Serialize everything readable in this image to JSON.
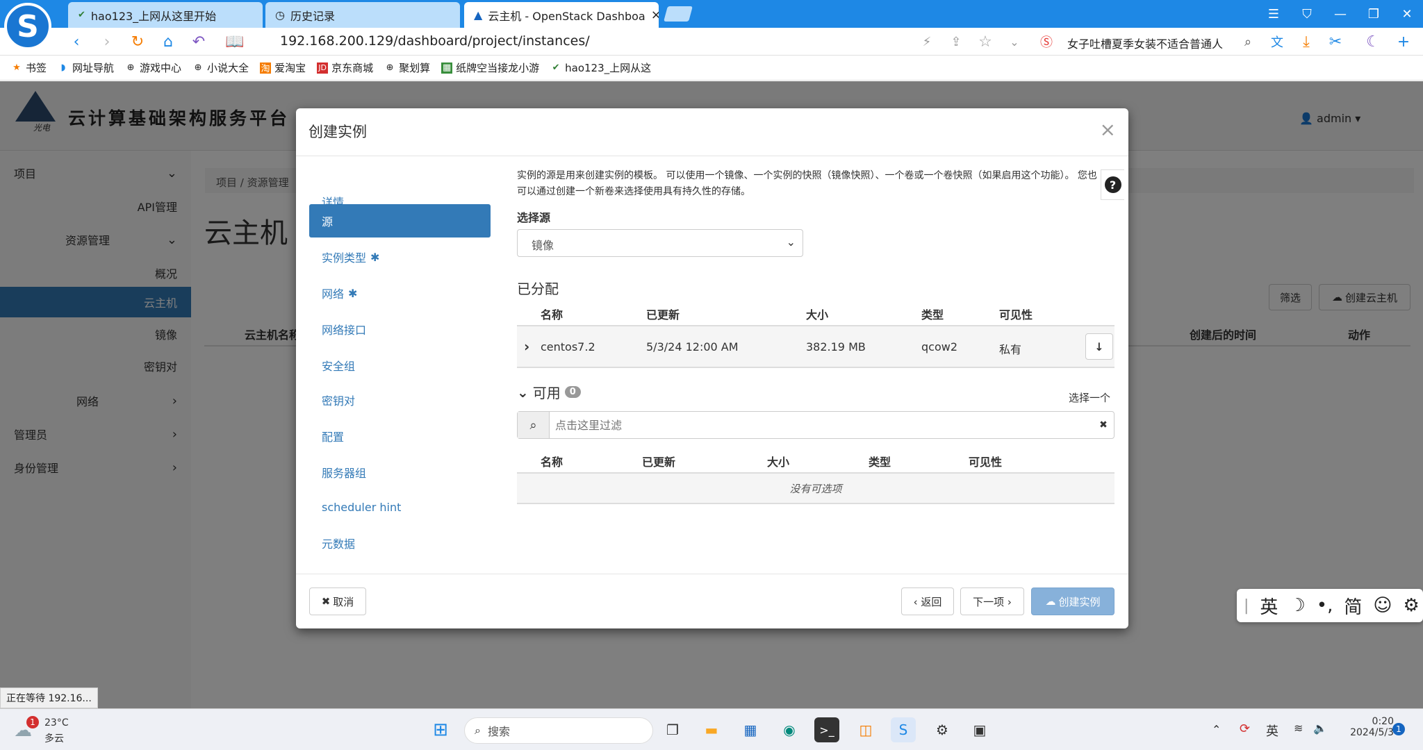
{
  "browser": {
    "logo": "S",
    "tabs": [
      {
        "label": "hao123_上网从这里开始",
        "icon": "hao123-icon"
      },
      {
        "label": "历史记录",
        "icon": "history-icon"
      },
      {
        "label": "云主机 - OpenStack Dashboa",
        "icon": "openstack-icon",
        "close": "×"
      }
    ],
    "url": "192.168.200.129/dashboard/project/instances/",
    "search_hint": "女子吐槽夏季女装不适合普通人",
    "bookmarks": [
      "书签",
      "网址导航",
      "游戏中心",
      "小说大全",
      "爱淘宝",
      "京东商城",
      "聚划算",
      "纸牌空当接龙小游",
      "hao123_上网从这"
    ]
  },
  "page": {
    "brand": "云计算基础架构服务平台",
    "brand_sub": "光电",
    "user": "admin",
    "title": "云主机",
    "breadcrumb": [
      "项目",
      "资源管理"
    ],
    "sidebar": [
      {
        "label": "项目"
      },
      {
        "label": "API管理"
      },
      {
        "label": "资源管理"
      },
      {
        "label": "概况"
      },
      {
        "label": "云主机"
      },
      {
        "label": "镜像"
      },
      {
        "label": "密钥对"
      },
      {
        "label": "网络"
      },
      {
        "label": "管理员"
      },
      {
        "label": "身份管理"
      }
    ],
    "filter_btn": "筛选",
    "create_btn": "创建云主机",
    "table_headers": [
      "云主机名称",
      "创建后的时间",
      "动作"
    ]
  },
  "modal": {
    "title": "创建实例",
    "close": "×",
    "steps": [
      {
        "label": "详情",
        "required": false
      },
      {
        "label": "源",
        "required": false
      },
      {
        "label": "实例类型",
        "required": true
      },
      {
        "label": "网络",
        "required": true
      },
      {
        "label": "网络接口",
        "required": false
      },
      {
        "label": "安全组",
        "required": false
      },
      {
        "label": "密钥对",
        "required": false
      },
      {
        "label": "配置",
        "required": false
      },
      {
        "label": "服务器组",
        "required": false
      },
      {
        "label": "scheduler hint",
        "required": false
      },
      {
        "label": "元数据",
        "required": false
      }
    ],
    "description": "实例的源是用来创建实例的模板。 可以使用一个镜像、一个实例的快照（镜像快照）、一个卷或一个卷快照（如果启用这个功能）。 您也可以通过创建一个新卷来选择使用具有持久性的存储。",
    "select_source_label": "选择源",
    "select_source_value": "镜像",
    "allocated_title": "已分配",
    "columns": [
      "名称",
      "已更新",
      "大小",
      "类型",
      "可见性"
    ],
    "allocated_rows": [
      {
        "name": "centos7.2",
        "updated": "5/3/24 12:00 AM",
        "size": "382.19 MB",
        "type": "qcow2",
        "visibility": "私有"
      }
    ],
    "available_title": "可用",
    "available_count": "0",
    "select_one": "选择一个",
    "filter_placeholder": "点击这里过滤",
    "no_items": "没有可选项",
    "cancel": "取消",
    "back": "‹ 返回",
    "next": "下一项 ›",
    "create": "创建实例"
  },
  "status": "正在等待 192.16...",
  "weather": {
    "temp": "23°C",
    "desc": "多云",
    "badge": "1"
  },
  "taskbar": {
    "search": "搜索",
    "ime": "英",
    "time": "0:20",
    "date": "2024/5/3",
    "notif": "1"
  },
  "ime_bar": {
    "lang": "英",
    "mode": "简"
  }
}
